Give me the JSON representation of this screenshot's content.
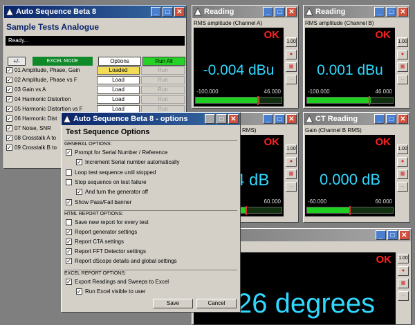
{
  "main_window": {
    "title": "Auto Sequence Beta 8",
    "subtitle": "Sample Tests Analogue",
    "status": "Ready...",
    "plusminus": "+/-",
    "excel_mode": "EXCEL MODE",
    "options": "Options",
    "run_all": "Run All",
    "tests": [
      {
        "label": "01 Amplitude, Phase, Gain",
        "load": "Loaded",
        "run": "Run"
      },
      {
        "label": "02 Amplitude, Phase vs F",
        "load": "Load",
        "run": "Run"
      },
      {
        "label": "03 Gain vs A",
        "load": "Load",
        "run": "Run"
      },
      {
        "label": "04 Harmonic Distortion",
        "load": "Load",
        "run": "Run"
      },
      {
        "label": "05 Harmonic Distortion vs F",
        "load": "Load",
        "run": "Run"
      },
      {
        "label": "06 Harmonic Dist",
        "load": "",
        "run": ""
      },
      {
        "label": "07 Noise, SNR",
        "load": "",
        "run": ""
      },
      {
        "label": "08 Crosstalk A to",
        "load": "",
        "run": ""
      },
      {
        "label": "09 Crosstalk B to",
        "load": "",
        "run": ""
      }
    ]
  },
  "readings": [
    {
      "title": "Reading",
      "label": "RMS amplitude (Channel A)",
      "status": "OK",
      "value": "-0.004 dBu",
      "scale_min": "-100.000",
      "scale_max": "46.000",
      "level": 0.74
    },
    {
      "title": "Reading",
      "label": "RMS amplitude (Channel B)",
      "status": "OK",
      "value": "0.001 dBu",
      "scale_min": "-100.000",
      "scale_max": "46.000",
      "level": 0.74
    },
    {
      "title": "",
      "label": "RMS)",
      "status": "OK",
      "value": "4 dB",
      "scale_min": "",
      "scale_max": "60.000",
      "level": 0.6
    },
    {
      "title": "CT Reading",
      "label": "Gain (Channel B RMS)",
      "status": "OK",
      "value": "0.000 dB",
      "scale_min": "-60.000",
      "scale_max": "60.000",
      "level": 0.5
    },
    {
      "title": "",
      "label": "",
      "status": "OK",
      "value": "26 degrees"
    }
  ],
  "side_buttons": [
    "1.00",
    "·",
    "·",
    "↔"
  ],
  "options_dialog": {
    "title": "Auto Sequence Beta 8 - options",
    "heading": "Test Sequence Options",
    "general_header": "GENERAL OPTIONS:",
    "prompt_serial": "Prompt for Serial Number / Reference",
    "increment_serial": "Increment Serial number automatically",
    "loop": "Loop test sequence until stopped",
    "stop_failure": "Stop sequence on test failure",
    "turn_gen_off": "And turn the generator off",
    "show_banner": "Show Pass/Fail banner",
    "html_header": "HTML REPORT OPTIONS:",
    "save_new": "Save new report for every test",
    "report_gen": "Report generator settings",
    "report_cta": "Report CTA settings",
    "report_fft": "Report FFT Detector settings",
    "report_dscope": "Report dScope details and global settings",
    "excel_header": "EXCEL REPORT OPTIONS:",
    "export_excel": "Export Readings and Sweeps to Excel",
    "run_excel": "Run Excel visible to user",
    "save": "Save",
    "cancel": "Cancel"
  },
  "colors": {
    "accent": "#0a246a",
    "value": "#30d8ff",
    "ok": "#ff2020",
    "run_all": "#27d227",
    "loaded": "#f3dc55"
  }
}
